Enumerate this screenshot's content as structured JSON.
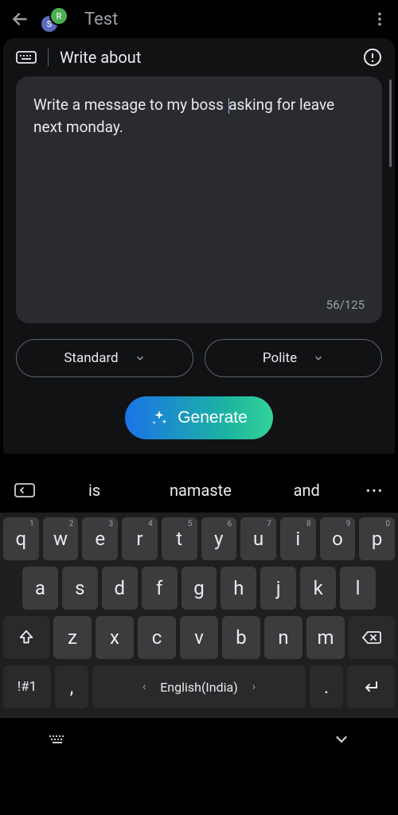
{
  "topbar": {
    "title": "Test",
    "avatar1": "R",
    "avatar2": "S"
  },
  "panel": {
    "title": "Write about"
  },
  "textbox": {
    "before": "Write a message to my boss ",
    "after": "asking for leave next monday.",
    "count": "56/125"
  },
  "chips": {
    "style": "Standard",
    "tone": "Polite"
  },
  "generate": {
    "label": "Generate"
  },
  "suggestions": {
    "s1": "is",
    "s2": "namaste",
    "s3": "and"
  },
  "keyboard": {
    "row1": [
      {
        "k": "q",
        "s": "1"
      },
      {
        "k": "w",
        "s": "2"
      },
      {
        "k": "e",
        "s": "3"
      },
      {
        "k": "r",
        "s": "4"
      },
      {
        "k": "t",
        "s": "5"
      },
      {
        "k": "y",
        "s": "6"
      },
      {
        "k": "u",
        "s": "7"
      },
      {
        "k": "i",
        "s": "8"
      },
      {
        "k": "o",
        "s": "9"
      },
      {
        "k": "p",
        "s": "0"
      }
    ],
    "row2": [
      "a",
      "s",
      "d",
      "f",
      "g",
      "h",
      "j",
      "k",
      "l"
    ],
    "row3": [
      "z",
      "x",
      "c",
      "v",
      "b",
      "n",
      "m"
    ],
    "symbols": "!#1",
    "comma": ",",
    "space_label": "English(India)",
    "period": "."
  }
}
